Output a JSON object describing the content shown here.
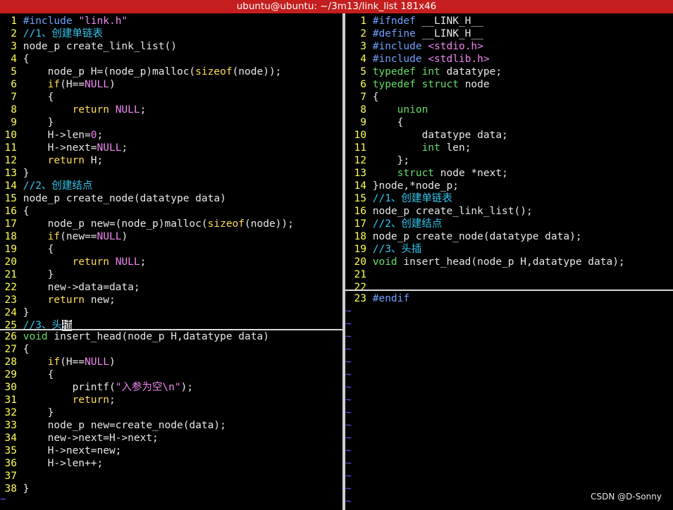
{
  "window": {
    "title": "ubuntu@ubuntu: ~/3m13/link_list 181x46"
  },
  "watermark": "CSDN @D-Sonny",
  "left_top": [
    {
      "n": "1",
      "segs": [
        [
          "pp",
          "#include "
        ],
        [
          "st",
          "\"link.h\""
        ]
      ]
    },
    {
      "n": "2",
      "segs": [
        [
          "cm",
          "//1、创建单链表"
        ]
      ]
    },
    {
      "n": "3",
      "segs": [
        [
          "fn",
          "node_p create_link_list()"
        ]
      ]
    },
    {
      "n": "4",
      "segs": [
        [
          "fn",
          "{"
        ]
      ]
    },
    {
      "n": "5",
      "segs": [
        [
          "fn",
          "    node_p H=(node_p)malloc("
        ],
        [
          "kw",
          "sizeof"
        ],
        [
          "fn",
          "(node));"
        ]
      ]
    },
    {
      "n": "6",
      "segs": [
        [
          "fn",
          "    "
        ],
        [
          "kw",
          "if"
        ],
        [
          "fn",
          "(H=="
        ],
        [
          "st",
          "NULL"
        ],
        [
          "fn",
          ")"
        ]
      ]
    },
    {
      "n": "7",
      "segs": [
        [
          "fn",
          "    {"
        ]
      ]
    },
    {
      "n": "8",
      "segs": [
        [
          "fn",
          "        "
        ],
        [
          "kw",
          "return"
        ],
        [
          "fn",
          " "
        ],
        [
          "st",
          "NULL"
        ],
        [
          "fn",
          ";"
        ]
      ]
    },
    {
      "n": "9",
      "segs": [
        [
          "fn",
          "    }"
        ]
      ]
    },
    {
      "n": "10",
      "segs": [
        [
          "fn",
          "    H->len="
        ],
        [
          "st",
          "0"
        ],
        [
          "fn",
          ";"
        ]
      ]
    },
    {
      "n": "11",
      "segs": [
        [
          "fn",
          "    H->next="
        ],
        [
          "st",
          "NULL"
        ],
        [
          "fn",
          ";"
        ]
      ]
    },
    {
      "n": "12",
      "segs": [
        [
          "fn",
          "    "
        ],
        [
          "kw",
          "return"
        ],
        [
          "fn",
          " H;"
        ]
      ]
    },
    {
      "n": "13",
      "segs": [
        [
          "fn",
          "}"
        ]
      ]
    },
    {
      "n": "14",
      "segs": [
        [
          "cm",
          "//2、创建结点"
        ]
      ]
    },
    {
      "n": "15",
      "segs": [
        [
          "fn",
          "node_p create_node(datatype data)"
        ]
      ]
    },
    {
      "n": "16",
      "segs": [
        [
          "fn",
          "{"
        ]
      ]
    },
    {
      "n": "17",
      "segs": [
        [
          "fn",
          "    node_p new=(node_p)malloc("
        ],
        [
          "kw",
          "sizeof"
        ],
        [
          "fn",
          "(node));"
        ]
      ]
    },
    {
      "n": "18",
      "segs": [
        [
          "fn",
          "    "
        ],
        [
          "kw",
          "if"
        ],
        [
          "fn",
          "(new=="
        ],
        [
          "st",
          "NULL"
        ],
        [
          "fn",
          ")"
        ]
      ]
    },
    {
      "n": "19",
      "segs": [
        [
          "fn",
          "    {"
        ]
      ]
    },
    {
      "n": "20",
      "segs": [
        [
          "fn",
          "        "
        ],
        [
          "kw",
          "return"
        ],
        [
          "fn",
          " "
        ],
        [
          "st",
          "NULL"
        ],
        [
          "fn",
          ";"
        ]
      ]
    },
    {
      "n": "21",
      "segs": [
        [
          "fn",
          "    }"
        ]
      ]
    },
    {
      "n": "22",
      "segs": [
        [
          "fn",
          "    new->data=data;"
        ]
      ]
    },
    {
      "n": "23",
      "segs": [
        [
          "fn",
          "    "
        ],
        [
          "kw",
          "return"
        ],
        [
          "fn",
          " new;"
        ]
      ]
    },
    {
      "n": "24",
      "segs": [
        [
          "fn",
          "}"
        ]
      ]
    },
    {
      "n": "25",
      "segs": [
        [
          "cm",
          "//3、头"
        ],
        [
          "cursor",
          "插"
        ]
      ]
    }
  ],
  "left_bottom": [
    {
      "n": "26",
      "segs": [
        [
          "ty",
          "void"
        ],
        [
          "fn",
          " insert_head(node_p H,datatype data)"
        ]
      ]
    },
    {
      "n": "27",
      "segs": [
        [
          "fn",
          "{"
        ]
      ]
    },
    {
      "n": "28",
      "segs": [
        [
          "fn",
          "    "
        ],
        [
          "kw",
          "if"
        ],
        [
          "fn",
          "(H=="
        ],
        [
          "st",
          "NULL"
        ],
        [
          "fn",
          ")"
        ]
      ]
    },
    {
      "n": "29",
      "segs": [
        [
          "fn",
          "    {"
        ]
      ]
    },
    {
      "n": "30",
      "segs": [
        [
          "fn",
          "        printf("
        ],
        [
          "st",
          "\"入参为空\\n\""
        ],
        [
          "fn",
          ");"
        ]
      ]
    },
    {
      "n": "31",
      "segs": [
        [
          "fn",
          "        "
        ],
        [
          "kw",
          "return"
        ],
        [
          "fn",
          ";"
        ]
      ]
    },
    {
      "n": "32",
      "segs": [
        [
          "fn",
          "    }"
        ]
      ]
    },
    {
      "n": "33",
      "segs": [
        [
          "fn",
          "    node_p new=create_node(data);"
        ]
      ]
    },
    {
      "n": "34",
      "segs": [
        [
          "fn",
          "    new->next=H->next;"
        ]
      ]
    },
    {
      "n": "35",
      "segs": [
        [
          "fn",
          "    H->next=new;"
        ]
      ]
    },
    {
      "n": "36",
      "segs": [
        [
          "fn",
          "    H->len++;"
        ]
      ]
    },
    {
      "n": "37",
      "segs": [
        [
          "fn",
          ""
        ]
      ]
    },
    {
      "n": "38",
      "segs": [
        [
          "fn",
          "}"
        ]
      ]
    }
  ],
  "right_top": [
    {
      "n": "1",
      "segs": [
        [
          "pp",
          "#ifndef"
        ],
        [
          "fn",
          " __LINK_H__"
        ]
      ]
    },
    {
      "n": "2",
      "segs": [
        [
          "pp",
          "#define"
        ],
        [
          "fn",
          " __LINK_H__"
        ]
      ]
    },
    {
      "n": "3",
      "segs": [
        [
          "pp",
          "#include "
        ],
        [
          "st",
          "<stdio.h>"
        ]
      ]
    },
    {
      "n": "4",
      "segs": [
        [
          "pp",
          "#include "
        ],
        [
          "st",
          "<stdlib.h>"
        ]
      ]
    },
    {
      "n": "5",
      "segs": [
        [
          "ty",
          "typedef"
        ],
        [
          "fn",
          " "
        ],
        [
          "ty",
          "int"
        ],
        [
          "fn",
          " datatype;"
        ]
      ]
    },
    {
      "n": "6",
      "segs": [
        [
          "ty",
          "typedef"
        ],
        [
          "fn",
          " "
        ],
        [
          "ty",
          "struct"
        ],
        [
          "fn",
          " node"
        ]
      ]
    },
    {
      "n": "7",
      "segs": [
        [
          "fn",
          "{"
        ]
      ]
    },
    {
      "n": "8",
      "segs": [
        [
          "fn",
          "    "
        ],
        [
          "ty",
          "union"
        ]
      ]
    },
    {
      "n": "9",
      "segs": [
        [
          "fn",
          "    {"
        ]
      ]
    },
    {
      "n": "10",
      "segs": [
        [
          "fn",
          "        datatype data;"
        ]
      ]
    },
    {
      "n": "11",
      "segs": [
        [
          "fn",
          "        "
        ],
        [
          "ty",
          "int"
        ],
        [
          "fn",
          " len;"
        ]
      ]
    },
    {
      "n": "12",
      "segs": [
        [
          "fn",
          "    };"
        ]
      ]
    },
    {
      "n": "13",
      "segs": [
        [
          "fn",
          "    "
        ],
        [
          "ty",
          "struct"
        ],
        [
          "fn",
          " node *next;"
        ]
      ]
    },
    {
      "n": "14",
      "segs": [
        [
          "fn",
          "}node,*node_p;"
        ]
      ]
    },
    {
      "n": "15",
      "segs": [
        [
          "cm",
          "//1、创建单链表"
        ]
      ]
    },
    {
      "n": "16",
      "segs": [
        [
          "fn",
          "node_p create_link_list();"
        ]
      ]
    },
    {
      "n": "17",
      "segs": [
        [
          "cm",
          "//2、创建结点"
        ]
      ]
    },
    {
      "n": "18",
      "segs": [
        [
          "fn",
          "node_p create_node(datatype data);"
        ]
      ]
    },
    {
      "n": "19",
      "segs": [
        [
          "cm",
          "//3、头插"
        ]
      ]
    },
    {
      "n": "20",
      "segs": [
        [
          "ty",
          "void"
        ],
        [
          "fn",
          " insert_head(node_p H,datatype data);"
        ]
      ]
    },
    {
      "n": "21",
      "segs": [
        [
          "fn",
          ""
        ]
      ]
    },
    {
      "n": "22",
      "segs": [
        [
          "fn",
          ""
        ]
      ]
    }
  ],
  "right_bottom": [
    {
      "n": "23",
      "segs": [
        [
          "pp",
          "#endif"
        ]
      ]
    }
  ],
  "tilde": "~",
  "colors": {
    "titlebar": "#c41e1e",
    "linenumber": "#ffff55"
  }
}
